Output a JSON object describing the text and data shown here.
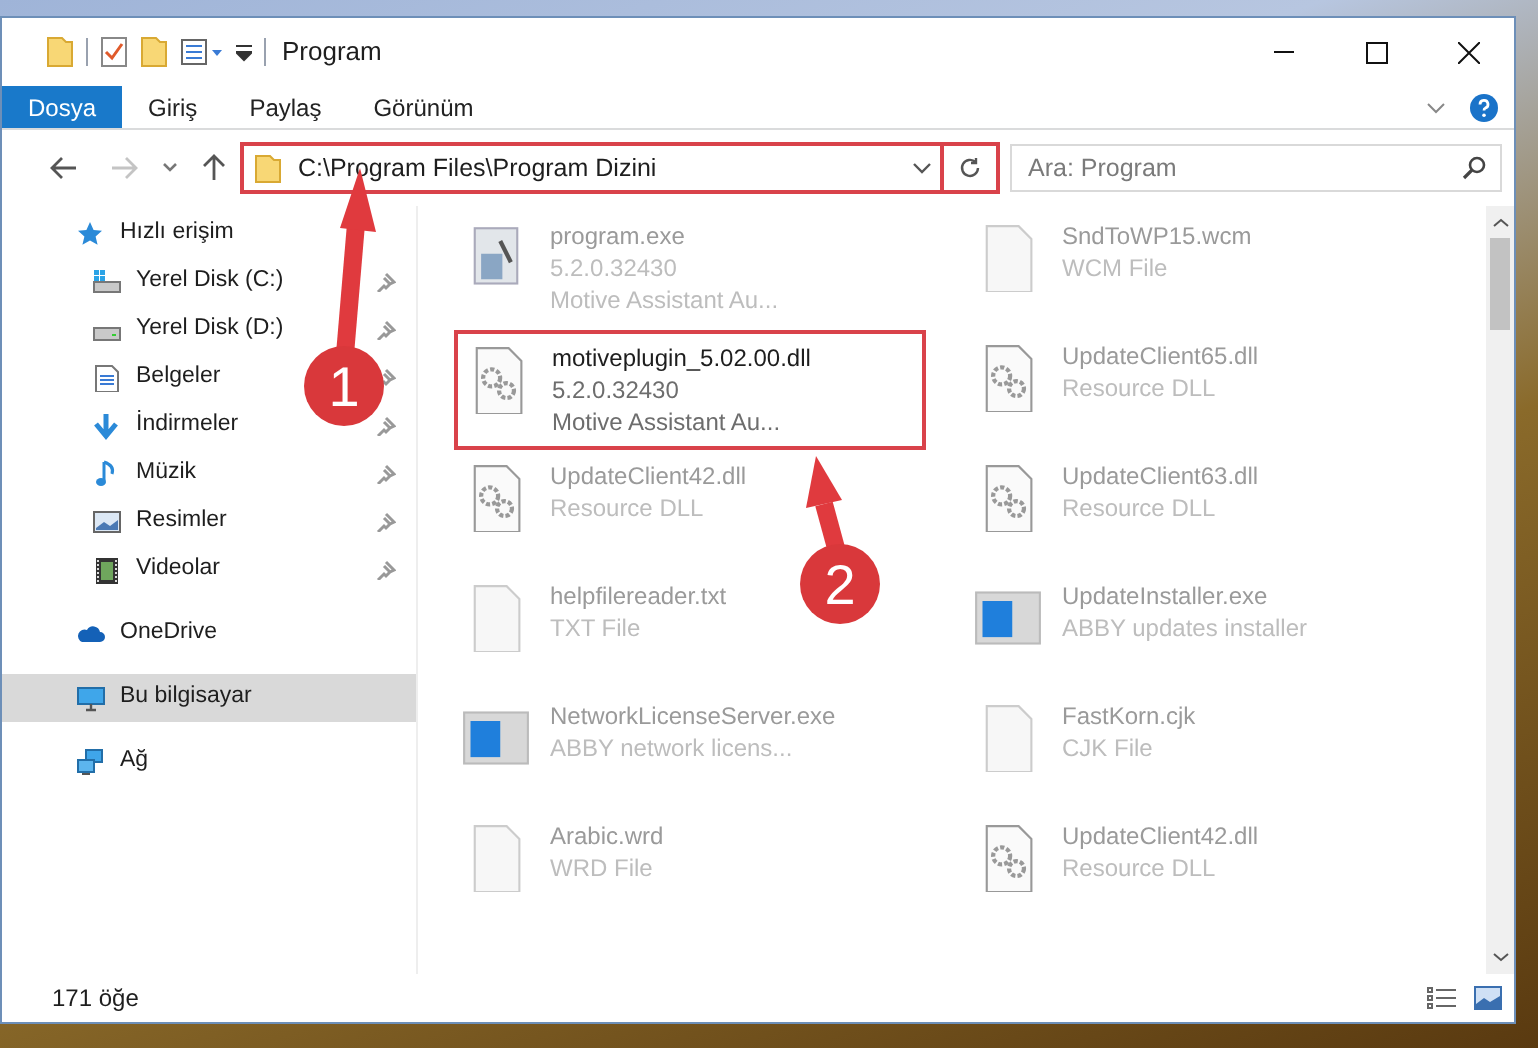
{
  "window": {
    "title": "Program"
  },
  "ribbon": {
    "tabs": [
      {
        "label": "Dosya",
        "selected": true
      },
      {
        "label": "Giriş",
        "selected": false
      },
      {
        "label": "Paylaş",
        "selected": false
      },
      {
        "label": "Görünüm",
        "selected": false
      }
    ]
  },
  "address_bar": {
    "path": "C:\\Program Files\\Program Dizini"
  },
  "search": {
    "placeholder": "Ara: Program"
  },
  "navigation": {
    "items": [
      {
        "label": "Hızlı erişim",
        "kind": "star",
        "selected": false,
        "children": [
          {
            "label": "Yerel Disk (C:)",
            "kind": "system-drive",
            "pinned": true
          },
          {
            "label": "Yerel Disk (D:)",
            "kind": "drive",
            "pinned": true
          },
          {
            "label": "Belgeler",
            "kind": "document",
            "pinned": true
          },
          {
            "label": "İndirmeler",
            "kind": "download",
            "pinned": true
          },
          {
            "label": "Müzik",
            "kind": "music",
            "pinned": true
          },
          {
            "label": "Resimler",
            "kind": "picture",
            "pinned": true
          },
          {
            "label": "Videolar",
            "kind": "video",
            "pinned": true
          }
        ]
      },
      {
        "label": "OneDrive",
        "kind": "cloud",
        "selected": false
      },
      {
        "label": "Bu bilgisayar",
        "kind": "computer",
        "selected": true
      },
      {
        "label": "Ağ",
        "kind": "network",
        "selected": false
      }
    ]
  },
  "files": [
    {
      "name": "program.exe",
      "line_2": "5.2.0.32430",
      "line_3": "Motive Assistant Au...",
      "kind": "installer",
      "selected": false
    },
    {
      "name": "SndToWP15.wcm",
      "line_2": "WCM File",
      "kind": "blank",
      "selected": false
    },
    {
      "name": "motiveplugin_5.02.00.dll",
      "line_2": "5.2.0.32430",
      "line_3": "Motive Assistant Au...",
      "kind": "dll",
      "selected": true
    },
    {
      "name": "UpdateClient65.dll",
      "line_2": "Resource DLL",
      "kind": "dll",
      "selected": false
    },
    {
      "name": "UpdateClient42.dll",
      "line_2": "Resource DLL",
      "kind": "dll",
      "selected": false
    },
    {
      "name": "UpdateClient63.dll",
      "line_2": "Resource DLL",
      "kind": "dll",
      "selected": false
    },
    {
      "name": "helpfilereader.txt",
      "line_2": "TXT File",
      "kind": "blank",
      "selected": false
    },
    {
      "name": "UpdateInstaller.exe",
      "line_2": "ABBY updates installer",
      "kind": "app",
      "selected": false
    },
    {
      "name": "NetworkLicenseServer.exe",
      "line_2": "ABBY network licens...",
      "kind": "app",
      "selected": false
    },
    {
      "name": "FastKorn.cjk",
      "line_2": "CJK File",
      "kind": "blank",
      "selected": false
    },
    {
      "name": "Arabic.wrd",
      "line_2": "WRD File",
      "kind": "blank",
      "selected": false
    },
    {
      "name": "UpdateClient42.dll",
      "line_2": "Resource DLL",
      "kind": "dll",
      "selected": false
    }
  ],
  "status_bar": {
    "item_count": "171 öğe"
  },
  "callouts": [
    {
      "label": "1"
    },
    {
      "label": "2"
    }
  ]
}
